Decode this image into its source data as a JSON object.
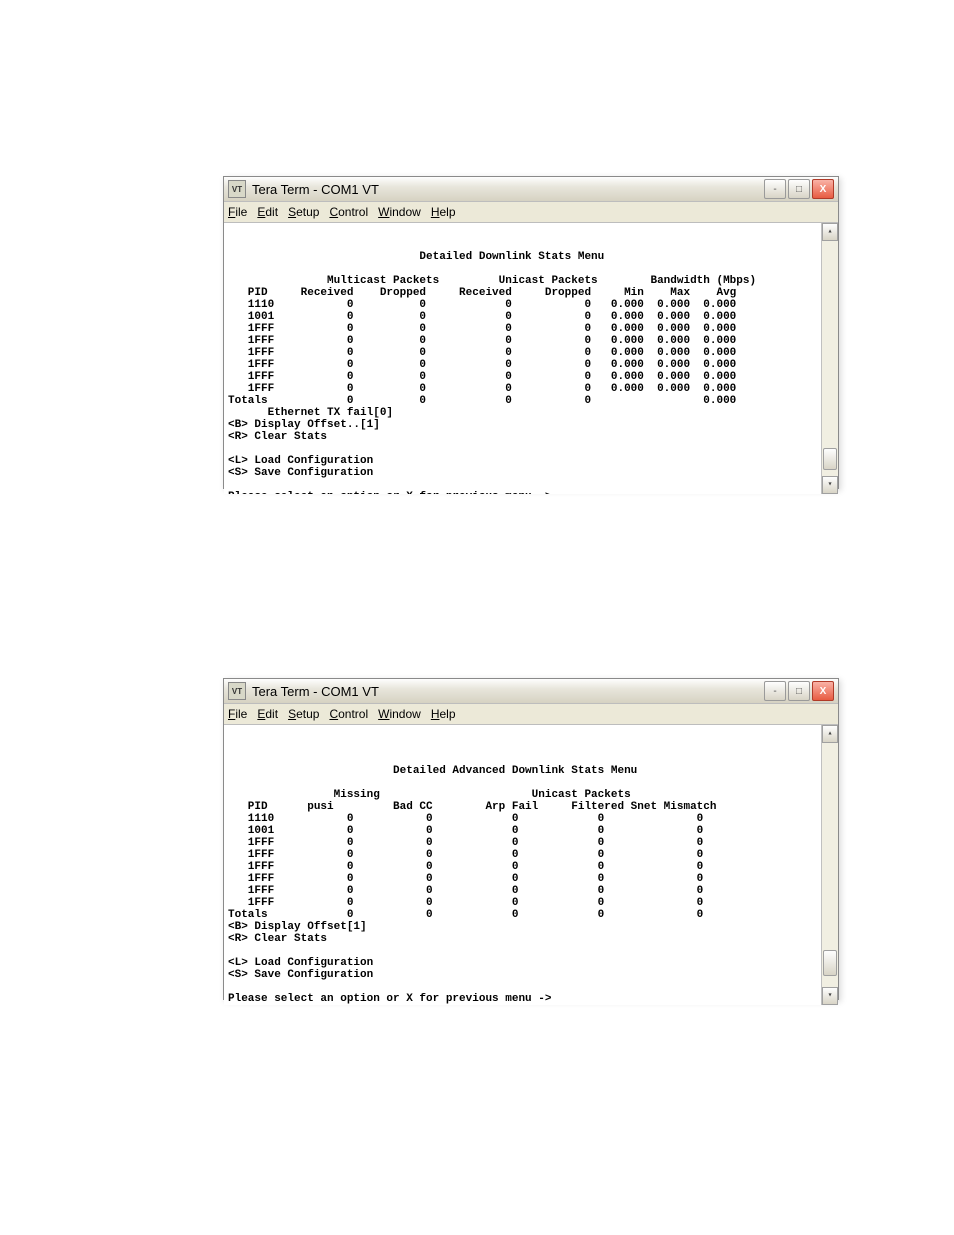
{
  "window_title": "Tera Term - COM1 VT",
  "menubar": [
    "File",
    "Edit",
    "Setup",
    "Control",
    "Window",
    "Help"
  ],
  "menu_ul_index": [
    0,
    0,
    0,
    0,
    0,
    0
  ],
  "term1": {
    "heading": "Detailed Downlink Stats Menu",
    "group1": "Multicast Packets",
    "group2": "Unicast Packets",
    "group3": "Bandwidth (Mbps)",
    "cols": [
      "PID",
      "Received",
      "Dropped",
      "Received",
      "Dropped",
      "Min",
      "Max",
      "Avg"
    ],
    "rows": [
      {
        "pid": "1110",
        "mr": "0",
        "md": "0",
        "ur": "0",
        "ud": "0",
        "min": "0.000",
        "max": "0.000",
        "avg": "0.000"
      },
      {
        "pid": "1001",
        "mr": "0",
        "md": "0",
        "ur": "0",
        "ud": "0",
        "min": "0.000",
        "max": "0.000",
        "avg": "0.000"
      },
      {
        "pid": "1FFF",
        "mr": "0",
        "md": "0",
        "ur": "0",
        "ud": "0",
        "min": "0.000",
        "max": "0.000",
        "avg": "0.000"
      },
      {
        "pid": "1FFF",
        "mr": "0",
        "md": "0",
        "ur": "0",
        "ud": "0",
        "min": "0.000",
        "max": "0.000",
        "avg": "0.000"
      },
      {
        "pid": "1FFF",
        "mr": "0",
        "md": "0",
        "ur": "0",
        "ud": "0",
        "min": "0.000",
        "max": "0.000",
        "avg": "0.000"
      },
      {
        "pid": "1FFF",
        "mr": "0",
        "md": "0",
        "ur": "0",
        "ud": "0",
        "min": "0.000",
        "max": "0.000",
        "avg": "0.000"
      },
      {
        "pid": "1FFF",
        "mr": "0",
        "md": "0",
        "ur": "0",
        "ud": "0",
        "min": "0.000",
        "max": "0.000",
        "avg": "0.000"
      },
      {
        "pid": "1FFF",
        "mr": "0",
        "md": "0",
        "ur": "0",
        "ud": "0",
        "min": "0.000",
        "max": "0.000",
        "avg": "0.000"
      }
    ],
    "totals": {
      "label": "Totals",
      "mr": "0",
      "md": "0",
      "ur": "0",
      "ud": "0",
      "avg": "0.000"
    },
    "eth_fail": "Ethernet TX fail[0]",
    "opt_b": "<B> Display Offset..[1]",
    "opt_r": "<R> Clear Stats",
    "opt_l": "<L> Load Configuration",
    "opt_s": "<S> Save Configuration",
    "prompt": "Please select an option or X for previous menu ->"
  },
  "term2": {
    "heading": "Detailed Advanced Downlink Stats Menu",
    "group1": "Missing",
    "group2": "Unicast Packets",
    "cols": [
      "PID",
      "pusi",
      "Bad CC",
      "Arp Fail",
      "Filtered",
      "Snet Mismatch"
    ],
    "rows": [
      {
        "pid": "1110",
        "pusi": "0",
        "bad": "0",
        "arp": "0",
        "filt": "0",
        "mis": "0"
      },
      {
        "pid": "1001",
        "pusi": "0",
        "bad": "0",
        "arp": "0",
        "filt": "0",
        "mis": "0"
      },
      {
        "pid": "1FFF",
        "pusi": "0",
        "bad": "0",
        "arp": "0",
        "filt": "0",
        "mis": "0"
      },
      {
        "pid": "1FFF",
        "pusi": "0",
        "bad": "0",
        "arp": "0",
        "filt": "0",
        "mis": "0"
      },
      {
        "pid": "1FFF",
        "pusi": "0",
        "bad": "0",
        "arp": "0",
        "filt": "0",
        "mis": "0"
      },
      {
        "pid": "1FFF",
        "pusi": "0",
        "bad": "0",
        "arp": "0",
        "filt": "0",
        "mis": "0"
      },
      {
        "pid": "1FFF",
        "pusi": "0",
        "bad": "0",
        "arp": "0",
        "filt": "0",
        "mis": "0"
      },
      {
        "pid": "1FFF",
        "pusi": "0",
        "bad": "0",
        "arp": "0",
        "filt": "0",
        "mis": "0"
      }
    ],
    "totals": {
      "label": "Totals",
      "pusi": "0",
      "bad": "0",
      "arp": "0",
      "filt": "0",
      "mis": "0"
    },
    "opt_b": "<B> Display Offset[1]",
    "opt_r": "<R> Clear Stats",
    "opt_l": "<L> Load Configuration",
    "opt_s": "<S> Save Configuration",
    "prompt": "Please select an option or X for previous menu ->"
  }
}
